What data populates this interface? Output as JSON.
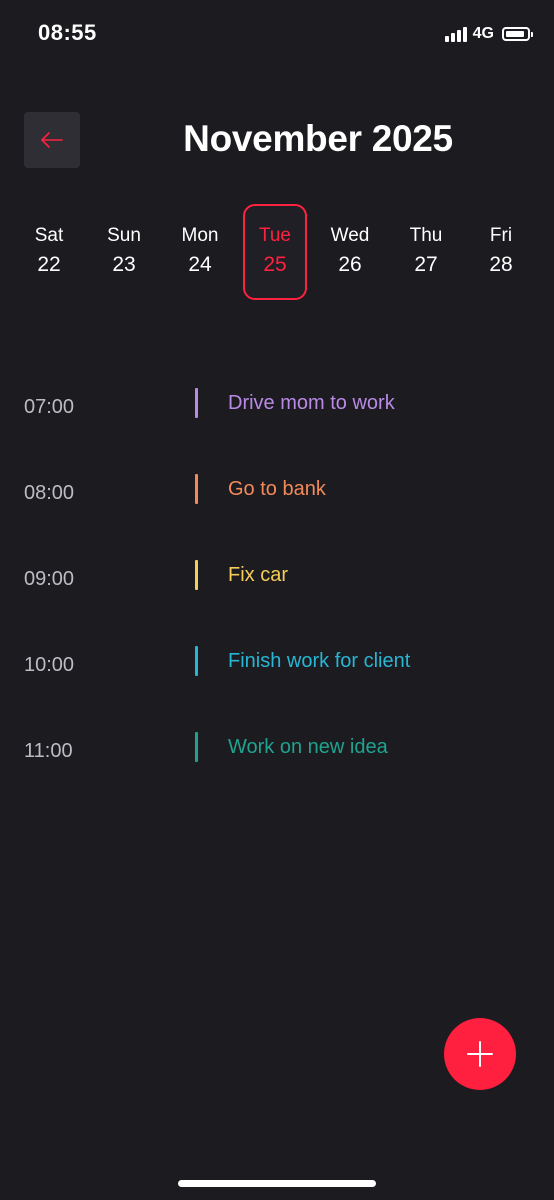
{
  "status_bar": {
    "time": "08:55",
    "network": "4G"
  },
  "header": {
    "title": "November 2025",
    "back_icon": "arrow-left-icon",
    "accent_color": "#ff2140"
  },
  "days": [
    {
      "name": "Sat",
      "number": "22",
      "selected": false
    },
    {
      "name": "Sun",
      "number": "23",
      "selected": false
    },
    {
      "name": "Mon",
      "number": "24",
      "selected": false
    },
    {
      "name": "Tue",
      "number": "25",
      "selected": true
    },
    {
      "name": "Wed",
      "number": "26",
      "selected": false
    },
    {
      "name": "Thu",
      "number": "27",
      "selected": false
    },
    {
      "name": "Fri",
      "number": "28",
      "selected": false
    }
  ],
  "agenda": [
    {
      "time": "07:00",
      "title": "Drive mom to work",
      "color": "#b98ae6"
    },
    {
      "time": "08:00",
      "title": "Go to bank",
      "color": "#f28a5a"
    },
    {
      "time": "09:00",
      "title": "Fix car",
      "color": "#f5cd58"
    },
    {
      "time": "10:00",
      "title": "Finish work for client",
      "color": "#27b6d4"
    },
    {
      "time": "11:00",
      "title": "Work on new idea",
      "color": "#1fa38f"
    }
  ],
  "fab": {
    "icon": "plus-icon",
    "color": "#ff1f3f"
  }
}
